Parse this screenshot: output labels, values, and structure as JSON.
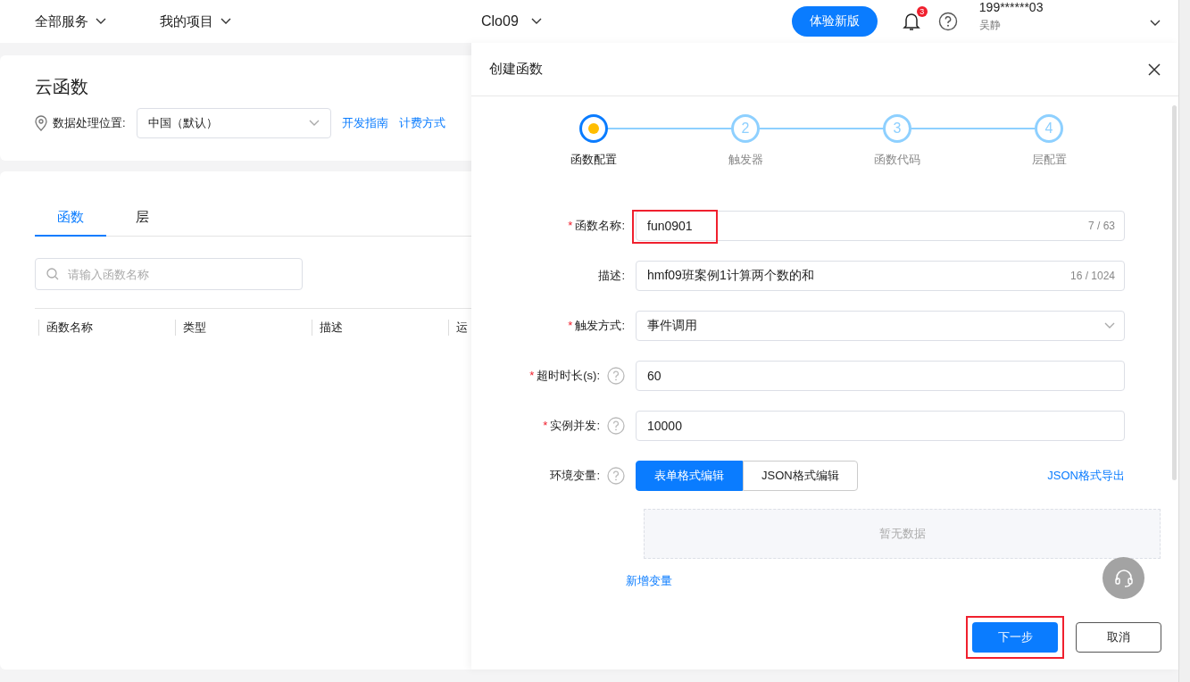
{
  "top_nav": {
    "menus": [
      {
        "label": "全部服务"
      },
      {
        "label": "我的项目"
      }
    ],
    "project": "Clo09",
    "new_version_button": "体验新版",
    "notification_count": "3",
    "account": {
      "phone": "199******03",
      "name": "吴静"
    }
  },
  "header_card": {
    "title": "云函数",
    "location_label": "数据处理位置:",
    "region_select": "中国（默认）",
    "links": [
      "开发指南",
      "计费方式"
    ]
  },
  "tabs": [
    {
      "label": "函数",
      "selected": true
    },
    {
      "label": "层",
      "selected": false
    }
  ],
  "search": {
    "placeholder": "请输入函数名称"
  },
  "table": {
    "columns": [
      "函数名称",
      "类型",
      "描述",
      "运"
    ]
  },
  "drawer": {
    "title": "创建函数",
    "steps": [
      {
        "label": "函数配置",
        "current": true
      },
      {
        "label": "触发器",
        "number": "2",
        "current": false
      },
      {
        "label": "函数代码",
        "number": "3",
        "current": false
      },
      {
        "label": "层配置",
        "number": "4",
        "current": false
      }
    ],
    "fields": [
      {
        "kind": "text",
        "required_mark": "*",
        "label": "函数名称:",
        "help": false,
        "value": "fun0901",
        "counter": "7 / 63",
        "highlighted": true
      },
      {
        "kind": "text",
        "label": "描述:",
        "help": false,
        "value": "hmf09班案例1计算两个数的和",
        "counter": "16 / 1024",
        "highlighted": false
      },
      {
        "kind": "select",
        "required_mark": "*",
        "label": "触发方式:",
        "help": false,
        "value": "事件调用",
        "highlighted": false
      },
      {
        "kind": "text",
        "required_mark": "*",
        "label": "超时时长(s):",
        "help": true,
        "value": "60",
        "highlighted": false
      },
      {
        "kind": "text",
        "required_mark": "*",
        "label": "实例并发:",
        "help": true,
        "value": "10000",
        "highlighted": false
      }
    ],
    "env": {
      "label": "环境变量:",
      "help": true,
      "modes": [
        {
          "label": "表单格式编辑",
          "selected": true
        },
        {
          "label": "JSON格式编辑",
          "selected": false
        }
      ],
      "export_link": "JSON格式导出",
      "empty_text": "暂无数据",
      "add_link": "新增变量"
    },
    "buttons": [
      {
        "label": "下一步",
        "kind": "primary",
        "highlighted": true
      },
      {
        "label": "取消",
        "kind": "default",
        "highlighted": false
      }
    ]
  }
}
